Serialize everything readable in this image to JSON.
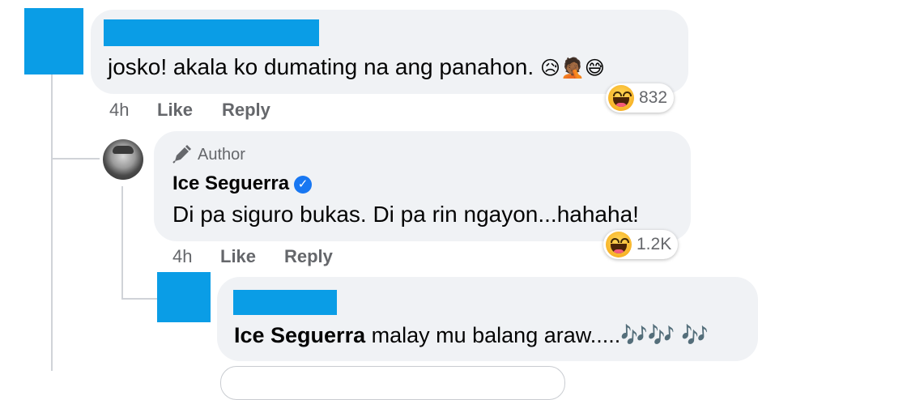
{
  "comment1": {
    "text": "josko! akala ko dumating na ang panahon.",
    "emojis": [
      "😥",
      "🤦🏾",
      "😅"
    ],
    "time": "4h",
    "like_label": "Like",
    "reply_label": "Reply",
    "reaction_count": "832"
  },
  "reply1": {
    "author_badge": "Author",
    "name": "Ice Seguerra",
    "text": "Di pa siguro bukas. Di pa rin ngayon...hahaha!",
    "time": "4h",
    "like_label": "Like",
    "reply_label": "Reply",
    "reaction_count": "1.2K"
  },
  "reply2": {
    "mention": "Ice Seguerra",
    "text": " malay mu balang araw.....🎶🎶 🎶"
  },
  "colors": {
    "redaction": "#0a9de6",
    "bubble": "#f0f2f5",
    "meta_text": "#65676b",
    "verified": "#1877f2"
  }
}
